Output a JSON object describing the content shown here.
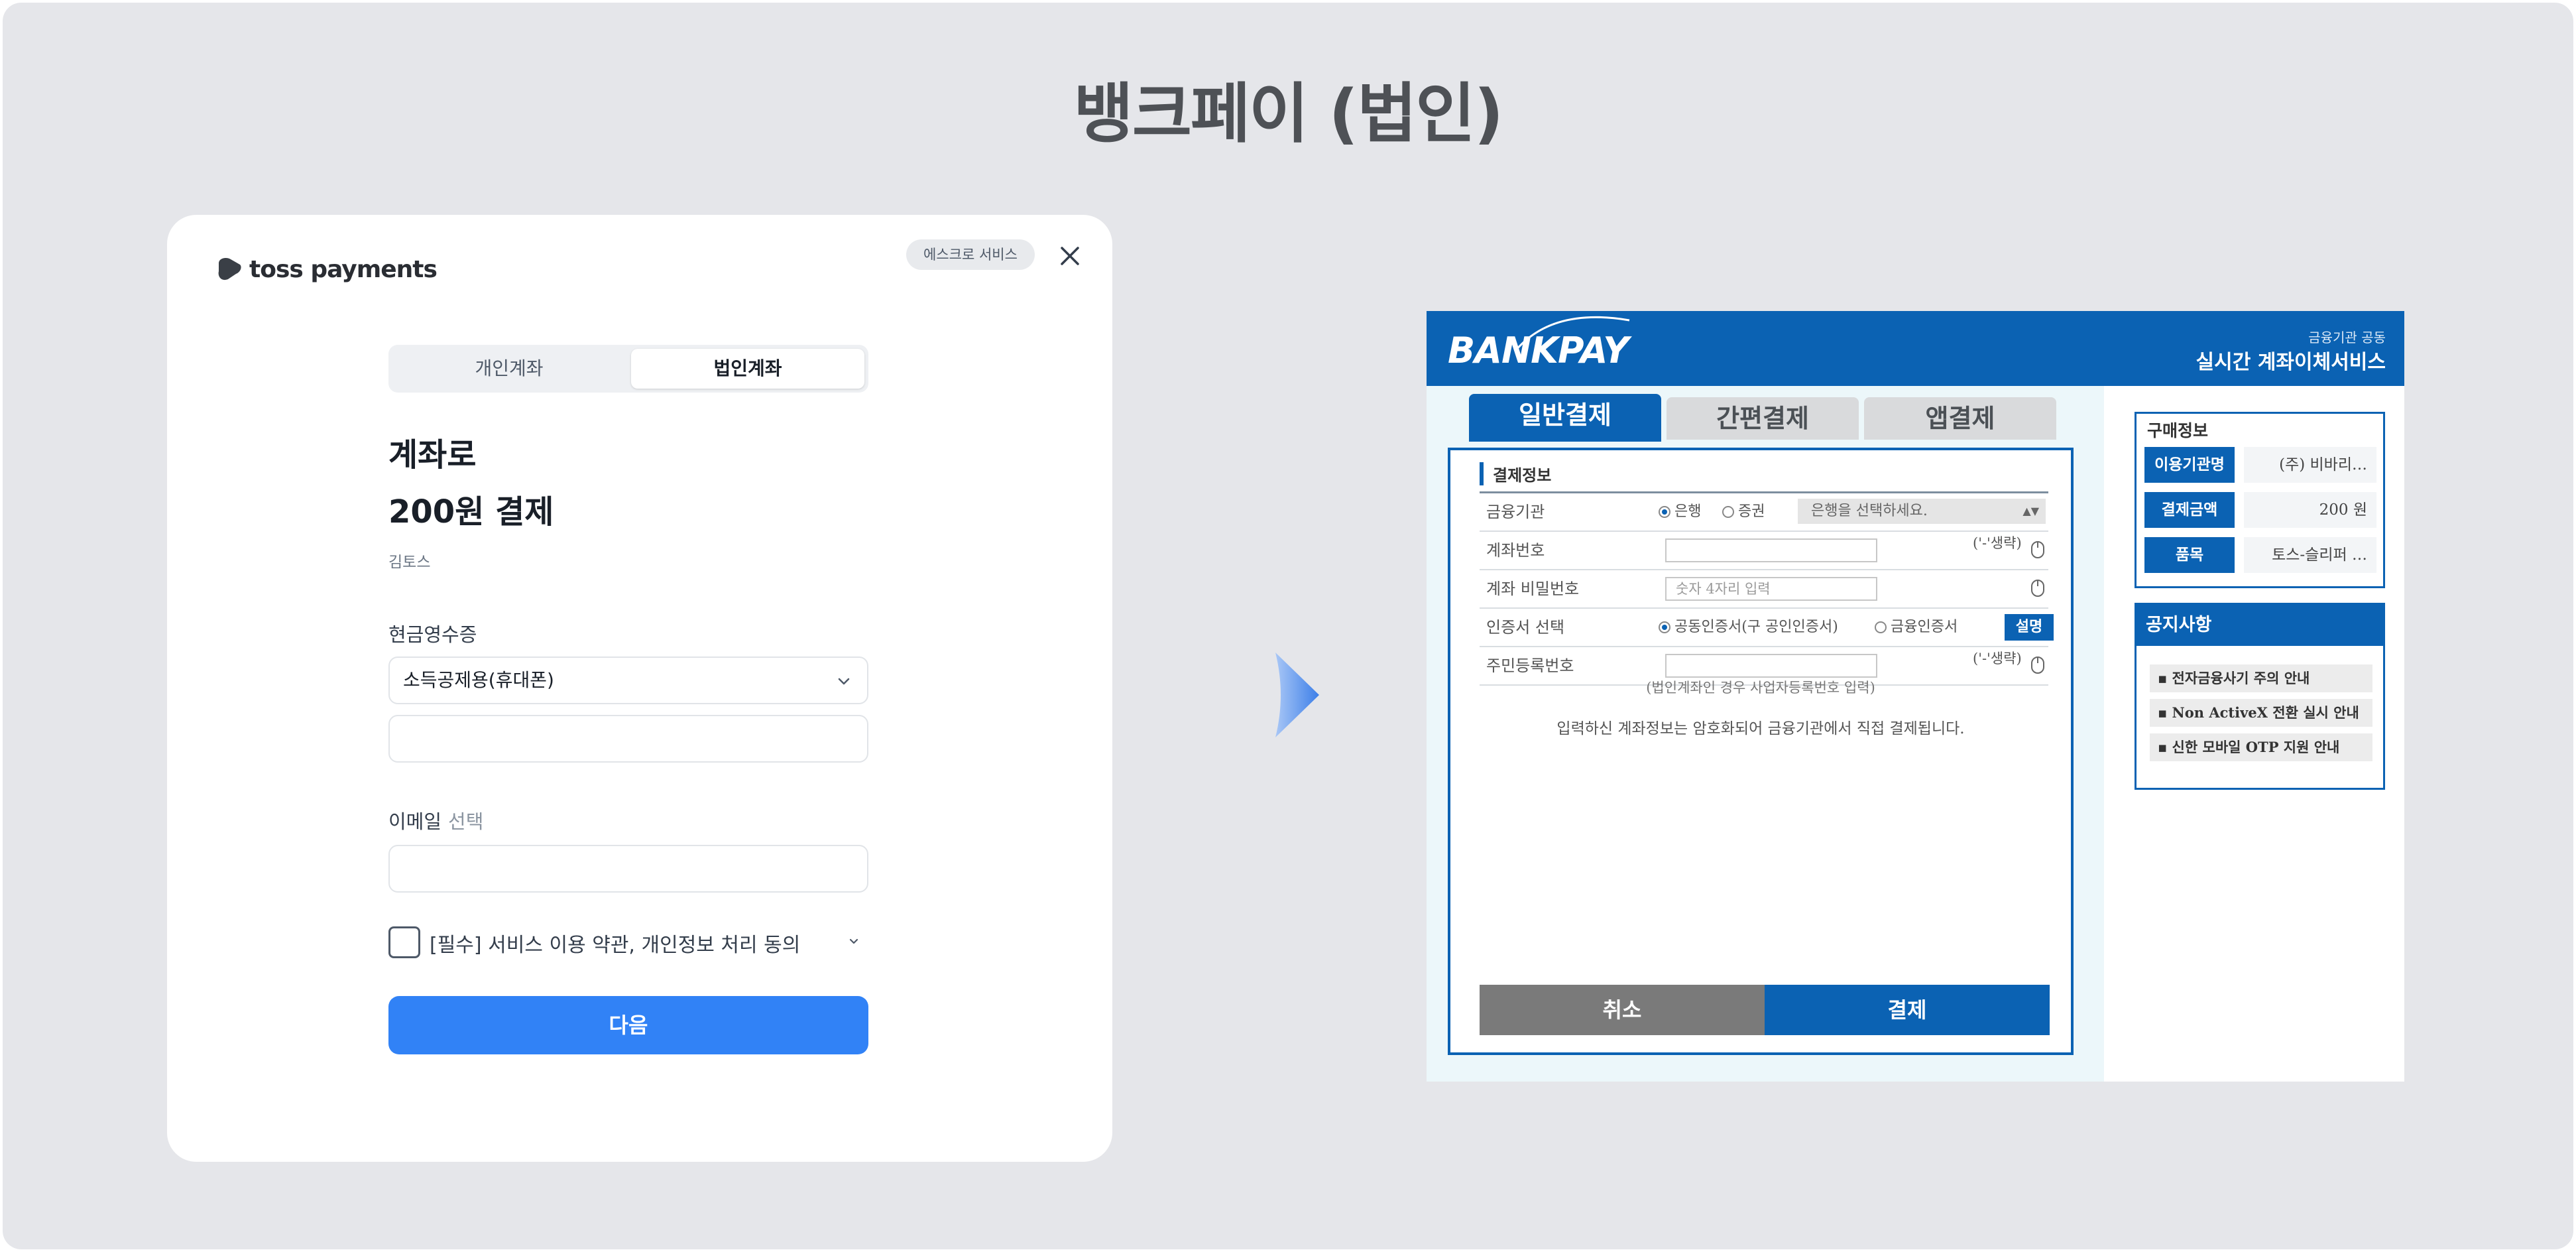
{
  "page": {
    "title": "뱅크페이 (법인)"
  },
  "toss": {
    "brand": "toss payments",
    "escrow_badge": "에스크로 서비스",
    "tabs": [
      "개인계좌",
      "법인계좌"
    ],
    "active_tab": "법인계좌",
    "heading_line1": "계좌로",
    "heading_line2": "200원 결제",
    "merchant": "김토스",
    "receipt_label": "현금영수증",
    "receipt_select_value": "소득공제용(휴대폰)",
    "phone_value": "",
    "email_label": "이메일",
    "email_optional": "선택",
    "email_value": "",
    "agreement_text": "[필수] 서비스 이용 약관, 개인정보 처리 동의",
    "agreement_checked": false,
    "next_button": "다음"
  },
  "bankpay": {
    "logo": "BANKPAY",
    "header_sub_small": "금융기관 공동",
    "header_sub_big": "실시간 계좌이체서비스",
    "tabs": [
      "일반결제",
      "간편결제",
      "앱결제"
    ],
    "active_tab": "일반결제",
    "section_title": "결제정보",
    "rows": {
      "institution": {
        "label": "금융기관",
        "radio_bank": "은행",
        "radio_securities": "증권",
        "select_placeholder": "은행을 선택하세요."
      },
      "account": {
        "label": "계좌번호",
        "note": "('-'생략)"
      },
      "password": {
        "label": "계좌 비밀번호",
        "placeholder": "숫자 4자리 입력"
      },
      "certificate": {
        "label": "인증서 선택",
        "radio_joint": "공동인증서(구 공인인증서)",
        "radio_financial": "금융인증서",
        "help_button": "설명"
      },
      "resident": {
        "label": "주민등록번호",
        "note": "('-'생략)"
      }
    },
    "corp_note": "(법인계좌인 경우 사업자등록번호 입력)",
    "encryption_note": "입력하신 계좌정보는 암호화되어 금융기관에서 직접 결제됩니다.",
    "cancel_button": "취소",
    "pay_button": "결제",
    "purchase": {
      "title": "구매정보",
      "items": [
        {
          "key": "이용기관명",
          "value": "(주) 비바리…"
        },
        {
          "key": "결제금액",
          "value": "200 원"
        },
        {
          "key": "품목",
          "value": "토스-슬리퍼 …"
        }
      ]
    },
    "notice": {
      "title": "공지사항",
      "items": [
        "전자금융사기 주의 안내",
        "Non ActiveX 전환 실시 안내",
        "신한 모바일 OTP 지원 안내"
      ]
    }
  },
  "colors": {
    "toss_blue": "#3182f6",
    "bankpay_blue": "#0b62b3",
    "background": "#e5e6ea"
  }
}
